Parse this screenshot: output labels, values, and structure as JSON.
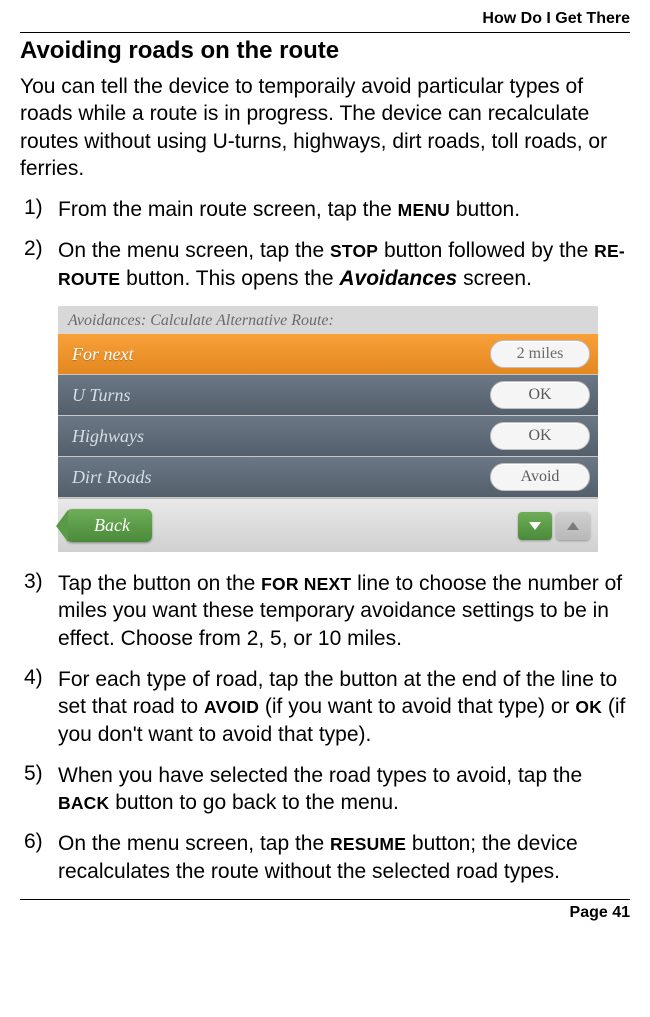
{
  "header": {
    "chapter": "How Do I Get There"
  },
  "section": {
    "title": "Avoiding roads on the route"
  },
  "intro": "You can tell the device to temporaily avoid particular types of roads while a route is in progress. The device can recalculate routes without using U-turns, highways, dirt roads, toll roads, or ferries.",
  "steps": [
    {
      "marker": "1)",
      "pre": "From the main route screen, tap the ",
      "k1": "MENU",
      "post": " button."
    },
    {
      "marker": "2)",
      "pre": "On the menu screen, tap the ",
      "k1": "STOP",
      "mid1": " button followed by the ",
      "k2": "RE-ROUTE",
      "mid2": " button. This opens the ",
      "em": "Avoidances",
      "post": " screen."
    },
    {
      "marker": "3)",
      "pre": "Tap the button on the ",
      "k1": "FOR NEXT",
      "post": " line to choose the number of miles you want these temporary avoidance settings to be in effect. Choose from 2, 5, or 10 miles."
    },
    {
      "marker": "4)",
      "pre": "For each type of road, tap the button at the end of the line to set that road to ",
      "k1": "AVOID",
      "mid1": " (if you want to avoid that type) or ",
      "k2": "OK",
      "post": " (if you don't want to avoid that type)."
    },
    {
      "marker": "5)",
      "pre": "When you have selected the road types to avoid, tap the ",
      "k1": "BACK",
      "post": " button to go back to the menu."
    },
    {
      "marker": "6)",
      "pre": "On the menu screen, tap the ",
      "k1": "RESUME",
      "post": " button; the device recalculates the route without the selected road types."
    }
  ],
  "screenshot": {
    "title": "Avoidances:   Calculate Alternative Route:",
    "rows": [
      {
        "label": "For next",
        "value": "2 miles",
        "style": "orange"
      },
      {
        "label": "U Turns",
        "value": "OK",
        "style": "blue"
      },
      {
        "label": "Highways",
        "value": "OK",
        "style": "blue"
      },
      {
        "label": "Dirt Roads",
        "value": "Avoid",
        "style": "blue"
      }
    ],
    "back_label": "Back"
  },
  "footer": {
    "page": "Page 41"
  }
}
